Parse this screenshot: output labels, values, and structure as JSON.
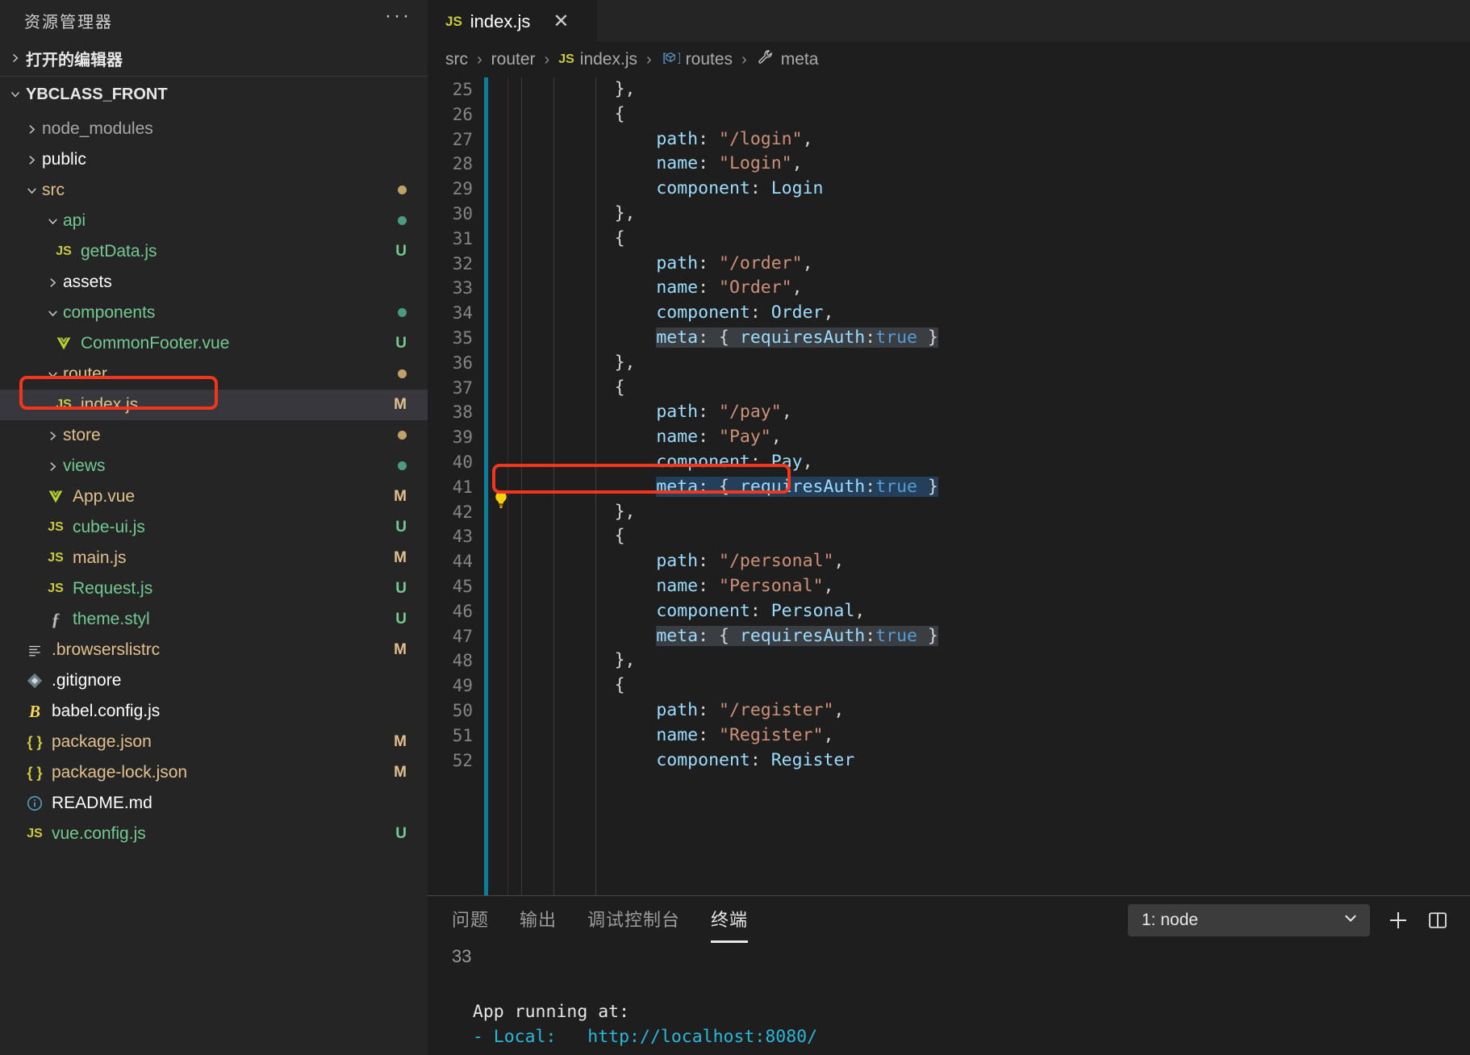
{
  "sidebar": {
    "title": "资源管理器",
    "more_label": "···",
    "open_editors_label": "打开的编辑器",
    "project_name": "YBCLASS_FRONT",
    "tree": [
      {
        "label": "node_modules",
        "kind": "folder",
        "indent": 1,
        "expanded": false,
        "icon": "chevron-right-icon",
        "badge": "",
        "badge_color": "",
        "name_color": "#a8a8a8"
      },
      {
        "label": "public",
        "kind": "folder",
        "indent": 1,
        "expanded": false,
        "icon": "chevron-right-icon",
        "badge": "",
        "badge_color": "",
        "name_color": "#ffffff"
      },
      {
        "label": "src",
        "kind": "folder",
        "indent": 1,
        "expanded": true,
        "icon": "chevron-down-icon",
        "badge": "dot",
        "badge_color": "#c0a06b",
        "name_color": "#e2c08d"
      },
      {
        "label": "api",
        "kind": "folder",
        "indent": 2,
        "expanded": true,
        "icon": "chevron-down-icon",
        "badge": "dot",
        "badge_color": "#4c9b7f",
        "name_color": "#73c991"
      },
      {
        "label": "getData.js",
        "kind": "js",
        "indent": 3,
        "expanded": null,
        "icon": "js-file-icon",
        "badge": "U",
        "badge_color": "#73c991",
        "name_color": "#73c991"
      },
      {
        "label": "assets",
        "kind": "folder",
        "indent": 2,
        "expanded": false,
        "icon": "chevron-right-icon",
        "badge": "",
        "badge_color": "",
        "name_color": "#ffffff"
      },
      {
        "label": "components",
        "kind": "folder",
        "indent": 2,
        "expanded": true,
        "icon": "chevron-down-icon",
        "badge": "dot",
        "badge_color": "#4c9b7f",
        "name_color": "#73c991"
      },
      {
        "label": "CommonFooter.vue",
        "kind": "vue",
        "indent": 3,
        "expanded": null,
        "icon": "vue-file-icon",
        "badge": "U",
        "badge_color": "#73c991",
        "name_color": "#73c991"
      },
      {
        "label": "router",
        "kind": "folder",
        "indent": 2,
        "expanded": true,
        "icon": "chevron-down-icon",
        "badge": "dot",
        "badge_color": "#c0a06b",
        "name_color": "#e2c08d"
      },
      {
        "label": "index.js",
        "kind": "js",
        "indent": 3,
        "expanded": null,
        "icon": "js-file-icon",
        "badge": "M",
        "badge_color": "#e2c08d",
        "name_color": "#e2c08d",
        "selected": true,
        "annotated": true
      },
      {
        "label": "store",
        "kind": "folder",
        "indent": 2,
        "expanded": false,
        "icon": "chevron-right-icon",
        "badge": "dot",
        "badge_color": "#c0a06b",
        "name_color": "#e2c08d"
      },
      {
        "label": "views",
        "kind": "folder",
        "indent": 2,
        "expanded": false,
        "icon": "chevron-right-icon",
        "badge": "dot",
        "badge_color": "#4c9b7f",
        "name_color": "#73c991"
      },
      {
        "label": "App.vue",
        "kind": "vue",
        "indent": 2,
        "expanded": null,
        "icon": "vue-file-icon",
        "badge": "M",
        "badge_color": "#e2c08d",
        "name_color": "#e2c08d"
      },
      {
        "label": "cube-ui.js",
        "kind": "js",
        "indent": 2,
        "expanded": null,
        "icon": "js-file-icon",
        "badge": "U",
        "badge_color": "#73c991",
        "name_color": "#73c991"
      },
      {
        "label": "main.js",
        "kind": "js",
        "indent": 2,
        "expanded": null,
        "icon": "js-file-icon",
        "badge": "M",
        "badge_color": "#e2c08d",
        "name_color": "#e2c08d"
      },
      {
        "label": "Request.js",
        "kind": "js",
        "indent": 2,
        "expanded": null,
        "icon": "js-file-icon",
        "badge": "U",
        "badge_color": "#73c991",
        "name_color": "#73c991"
      },
      {
        "label": "theme.styl",
        "kind": "styl",
        "indent": 2,
        "expanded": null,
        "icon": "stylus-file-icon",
        "badge": "U",
        "badge_color": "#73c991",
        "name_color": "#73c991"
      },
      {
        "label": ".browserslistrc",
        "kind": "conf",
        "indent": 1,
        "expanded": null,
        "icon": "list-file-icon",
        "badge": "M",
        "badge_color": "#e2c08d",
        "name_color": "#e2c08d"
      },
      {
        "label": ".gitignore",
        "kind": "git",
        "indent": 1,
        "expanded": null,
        "icon": "git-file-icon",
        "badge": "",
        "badge_color": "",
        "name_color": "#ffffff"
      },
      {
        "label": "babel.config.js",
        "kind": "babel",
        "indent": 1,
        "expanded": null,
        "icon": "babel-file-icon",
        "badge": "",
        "badge_color": "",
        "name_color": "#ffffff"
      },
      {
        "label": "package.json",
        "kind": "json",
        "indent": 1,
        "expanded": null,
        "icon": "json-file-icon",
        "badge": "M",
        "badge_color": "#e2c08d",
        "name_color": "#e2c08d"
      },
      {
        "label": "package-lock.json",
        "kind": "json",
        "indent": 1,
        "expanded": null,
        "icon": "json-file-icon",
        "badge": "M",
        "badge_color": "#e2c08d",
        "name_color": "#e2c08d"
      },
      {
        "label": "README.md",
        "kind": "md",
        "indent": 1,
        "expanded": null,
        "icon": "readme-file-icon",
        "badge": "",
        "badge_color": "",
        "name_color": "#ffffff"
      },
      {
        "label": "vue.config.js",
        "kind": "js",
        "indent": 1,
        "expanded": null,
        "icon": "js-file-icon",
        "badge": "U",
        "badge_color": "#73c991",
        "name_color": "#73c991"
      }
    ]
  },
  "editor": {
    "tab": {
      "label": "index.js",
      "icon": "js-file-icon",
      "close_label": "✕"
    },
    "breadcrumb": [
      {
        "label": "src",
        "icon": ""
      },
      {
        "label": "router",
        "icon": ""
      },
      {
        "label": "index.js",
        "icon": "js-file-icon"
      },
      {
        "label": "routes",
        "icon": "array-symbol-icon"
      },
      {
        "label": "meta",
        "icon": "wrench-symbol-icon"
      }
    ],
    "first_line_number": 25,
    "lines": [
      {
        "n": 25,
        "indent": 4,
        "tokens": [
          {
            "t": "},",
            "c": "t-punc"
          }
        ]
      },
      {
        "n": 26,
        "indent": 4,
        "tokens": [
          {
            "t": "{",
            "c": "t-punc"
          }
        ]
      },
      {
        "n": 27,
        "indent": 6,
        "tokens": [
          {
            "t": "path",
            "c": "t-key"
          },
          {
            "t": ": ",
            "c": "t-punc"
          },
          {
            "t": "\"/login\"",
            "c": "t-str"
          },
          {
            "t": ",",
            "c": "t-punc"
          }
        ]
      },
      {
        "n": 28,
        "indent": 6,
        "tokens": [
          {
            "t": "name",
            "c": "t-key"
          },
          {
            "t": ": ",
            "c": "t-punc"
          },
          {
            "t": "\"Login\"",
            "c": "t-str"
          },
          {
            "t": ",",
            "c": "t-punc"
          }
        ]
      },
      {
        "n": 29,
        "indent": 6,
        "tokens": [
          {
            "t": "component",
            "c": "t-key"
          },
          {
            "t": ": ",
            "c": "t-punc"
          },
          {
            "t": "Login",
            "c": "t-ident"
          }
        ]
      },
      {
        "n": 30,
        "indent": 4,
        "tokens": [
          {
            "t": "},",
            "c": "t-punc"
          }
        ]
      },
      {
        "n": 31,
        "indent": 4,
        "tokens": [
          {
            "t": "{",
            "c": "t-punc"
          }
        ]
      },
      {
        "n": 32,
        "indent": 6,
        "tokens": [
          {
            "t": "path",
            "c": "t-key"
          },
          {
            "t": ": ",
            "c": "t-punc"
          },
          {
            "t": "\"/order\"",
            "c": "t-str"
          },
          {
            "t": ",",
            "c": "t-punc"
          }
        ]
      },
      {
        "n": 33,
        "indent": 6,
        "tokens": [
          {
            "t": "name",
            "c": "t-key"
          },
          {
            "t": ": ",
            "c": "t-punc"
          },
          {
            "t": "\"Order\"",
            "c": "t-str"
          },
          {
            "t": ",",
            "c": "t-punc"
          }
        ]
      },
      {
        "n": 34,
        "indent": 6,
        "tokens": [
          {
            "t": "component",
            "c": "t-key"
          },
          {
            "t": ": ",
            "c": "t-punc"
          },
          {
            "t": "Order",
            "c": "t-ident"
          },
          {
            "t": ",",
            "c": "t-punc"
          }
        ]
      },
      {
        "n": 35,
        "indent": 6,
        "highlight": true,
        "tokens": [
          {
            "t": "meta",
            "c": "t-key"
          },
          {
            "t": ": { ",
            "c": "t-punc"
          },
          {
            "t": "requiresAuth",
            "c": "t-key"
          },
          {
            "t": ":",
            "c": "t-punc"
          },
          {
            "t": "true",
            "c": "t-bool"
          },
          {
            "t": " }",
            "c": "t-punc"
          }
        ]
      },
      {
        "n": 36,
        "indent": 4,
        "tokens": [
          {
            "t": "},",
            "c": "t-punc"
          }
        ]
      },
      {
        "n": 37,
        "indent": 4,
        "tokens": [
          {
            "t": "{",
            "c": "t-punc"
          }
        ]
      },
      {
        "n": 38,
        "indent": 6,
        "tokens": [
          {
            "t": "path",
            "c": "t-key"
          },
          {
            "t": ": ",
            "c": "t-punc"
          },
          {
            "t": "\"/pay\"",
            "c": "t-str"
          },
          {
            "t": ",",
            "c": "t-punc"
          }
        ]
      },
      {
        "n": 39,
        "indent": 6,
        "tokens": [
          {
            "t": "name",
            "c": "t-key"
          },
          {
            "t": ": ",
            "c": "t-punc"
          },
          {
            "t": "\"Pay\"",
            "c": "t-str"
          },
          {
            "t": ",",
            "c": "t-punc"
          }
        ]
      },
      {
        "n": 40,
        "indent": 6,
        "tokens": [
          {
            "t": "component",
            "c": "t-key"
          },
          {
            "t": ": ",
            "c": "t-punc"
          },
          {
            "t": "Pay",
            "c": "t-ident"
          },
          {
            "t": ",",
            "c": "t-punc"
          }
        ]
      },
      {
        "n": 41,
        "indent": 6,
        "selected": true,
        "bulb": true,
        "annotated": true,
        "tokens": [
          {
            "t": "meta",
            "c": "t-key"
          },
          {
            "t": ": { ",
            "c": "t-punc"
          },
          {
            "t": "requiresAuth",
            "c": "t-key"
          },
          {
            "t": ":",
            "c": "t-punc"
          },
          {
            "t": "true",
            "c": "t-bool"
          },
          {
            "t": " }",
            "c": "t-punc"
          }
        ]
      },
      {
        "n": 42,
        "indent": 4,
        "tokens": [
          {
            "t": "},",
            "c": "t-punc"
          }
        ]
      },
      {
        "n": 43,
        "indent": 4,
        "tokens": [
          {
            "t": "{",
            "c": "t-punc"
          }
        ]
      },
      {
        "n": 44,
        "indent": 6,
        "tokens": [
          {
            "t": "path",
            "c": "t-key"
          },
          {
            "t": ": ",
            "c": "t-punc"
          },
          {
            "t": "\"/personal\"",
            "c": "t-str"
          },
          {
            "t": ",",
            "c": "t-punc"
          }
        ]
      },
      {
        "n": 45,
        "indent": 6,
        "tokens": [
          {
            "t": "name",
            "c": "t-key"
          },
          {
            "t": ": ",
            "c": "t-punc"
          },
          {
            "t": "\"Personal\"",
            "c": "t-str"
          },
          {
            "t": ",",
            "c": "t-punc"
          }
        ]
      },
      {
        "n": 46,
        "indent": 6,
        "tokens": [
          {
            "t": "component",
            "c": "t-key"
          },
          {
            "t": ": ",
            "c": "t-punc"
          },
          {
            "t": "Personal",
            "c": "t-ident"
          },
          {
            "t": ",",
            "c": "t-punc"
          }
        ]
      },
      {
        "n": 47,
        "indent": 6,
        "highlight": true,
        "tokens": [
          {
            "t": "meta",
            "c": "t-key"
          },
          {
            "t": ": { ",
            "c": "t-punc"
          },
          {
            "t": "requiresAuth",
            "c": "t-key"
          },
          {
            "t": ":",
            "c": "t-punc"
          },
          {
            "t": "true",
            "c": "t-bool"
          },
          {
            "t": " }",
            "c": "t-punc"
          }
        ]
      },
      {
        "n": 48,
        "indent": 4,
        "tokens": [
          {
            "t": "},",
            "c": "t-punc"
          }
        ]
      },
      {
        "n": 49,
        "indent": 4,
        "tokens": [
          {
            "t": "{",
            "c": "t-punc"
          }
        ]
      },
      {
        "n": 50,
        "indent": 6,
        "tokens": [
          {
            "t": "path",
            "c": "t-key"
          },
          {
            "t": ": ",
            "c": "t-punc"
          },
          {
            "t": "\"/register\"",
            "c": "t-str"
          },
          {
            "t": ",",
            "c": "t-punc"
          }
        ]
      },
      {
        "n": 51,
        "indent": 6,
        "tokens": [
          {
            "t": "name",
            "c": "t-key"
          },
          {
            "t": ": ",
            "c": "t-punc"
          },
          {
            "t": "\"Register\"",
            "c": "t-str"
          },
          {
            "t": ",",
            "c": "t-punc"
          }
        ]
      },
      {
        "n": 52,
        "indent": 6,
        "tokens": [
          {
            "t": "component",
            "c": "t-key"
          },
          {
            "t": ": ",
            "c": "t-punc"
          },
          {
            "t": "Register",
            "c": "t-ident"
          }
        ]
      }
    ]
  },
  "panel": {
    "tabs": [
      {
        "label": "问题",
        "active": false
      },
      {
        "label": "输出",
        "active": false
      },
      {
        "label": "调试控制台",
        "active": false
      },
      {
        "label": "终端",
        "active": true
      }
    ],
    "terminal_select": {
      "value": "1: node",
      "chevron": "chevron-down-icon"
    },
    "add_label": "+",
    "split_label": "split-editor-icon",
    "line_count": "33",
    "output": [
      {
        "text": "  App running at:",
        "cls": "t-white-b"
      },
      {
        "text": "  - Local:   http://localhost:8080/",
        "cls": "t-cyan"
      }
    ]
  },
  "colors": {
    "accent_blue": "#0c7d9d",
    "annotation_red": "#f1361d",
    "modified_badge": "#e2c08d",
    "untracked_badge": "#73c991",
    "sidebar_bg": "#252526",
    "editor_bg": "#1e1e1e"
  }
}
